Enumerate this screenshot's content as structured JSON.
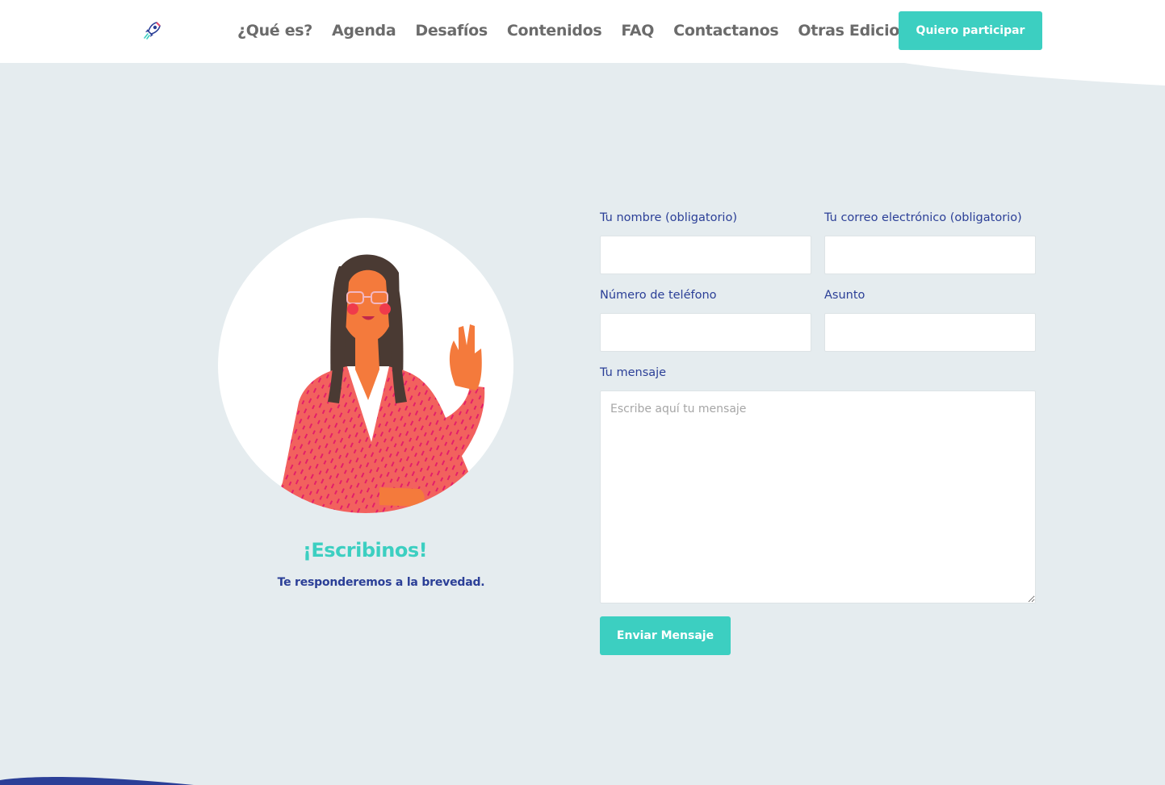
{
  "header": {
    "logo_icon": "rocket-icon",
    "nav": [
      {
        "label": "¿Qué es?"
      },
      {
        "label": "Agenda"
      },
      {
        "label": "Desafíos"
      },
      {
        "label": "Contenidos"
      },
      {
        "label": "FAQ"
      },
      {
        "label": "Contactanos"
      },
      {
        "label": "Otras Ediciones"
      }
    ],
    "cta_label": "Quiero participar"
  },
  "contact": {
    "title": "¡Escribinos!",
    "subtitle": "Te responderemos a la brevedad.",
    "illustration": "woman-waving-illustration"
  },
  "form": {
    "name_label": "Tu nombre (obligatorio)",
    "name_value": "",
    "email_label": "Tu correo electrónico (obligatorio)",
    "email_value": "",
    "phone_label": "Número de teléfono",
    "phone_value": "",
    "subject_label": "Asunto",
    "subject_value": "",
    "message_label": "Tu mensaje",
    "message_placeholder": "Escribe aquí tu mensaje",
    "submit_label": "Enviar Mensaje"
  },
  "colors": {
    "accent": "#3ccfc1",
    "label": "#2b3f97",
    "background": "#e5ecef",
    "nav_text": "#6b6b6b",
    "footer_wave": "#2b3f97"
  }
}
